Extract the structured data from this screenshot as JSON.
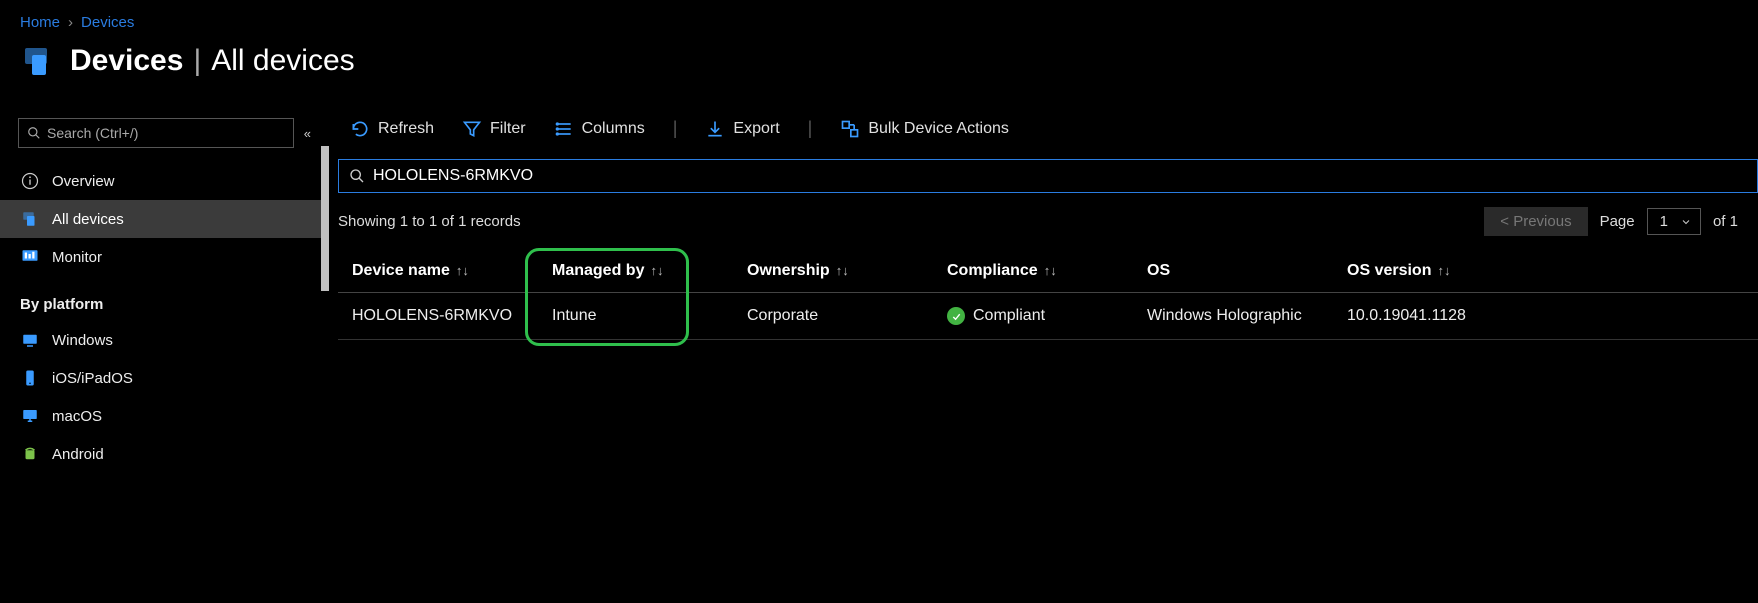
{
  "breadcrumb": {
    "home": "Home",
    "devices": "Devices"
  },
  "title": {
    "bold": "Devices",
    "rest": "All devices"
  },
  "sidebar": {
    "search_placeholder": "Search (Ctrl+/)",
    "overview": "Overview",
    "all_devices": "All devices",
    "monitor": "Monitor",
    "section_platform": "By platform",
    "windows": "Windows",
    "ios": "iOS/iPadOS",
    "macos": "macOS",
    "android": "Android"
  },
  "toolbar": {
    "refresh": "Refresh",
    "filter": "Filter",
    "columns": "Columns",
    "export": "Export",
    "bulk": "Bulk Device Actions"
  },
  "main_search_value": "HOLOLENS-6RMKVO",
  "records_text": "Showing 1 to 1 of 1 records",
  "pager": {
    "previous": "< Previous",
    "page_label": "Page",
    "page_num": "1",
    "of_text": "of 1"
  },
  "columns": {
    "device_name": "Device name",
    "managed_by": "Managed by",
    "ownership": "Ownership",
    "compliance": "Compliance",
    "os": "OS",
    "os_version": "OS version"
  },
  "row": {
    "device_name": "HOLOLENS-6RMKVO",
    "managed_by": "Intune",
    "ownership": "Corporate",
    "compliance": "Compliant",
    "os": "Windows Holographic",
    "os_version": "10.0.19041.1128"
  }
}
